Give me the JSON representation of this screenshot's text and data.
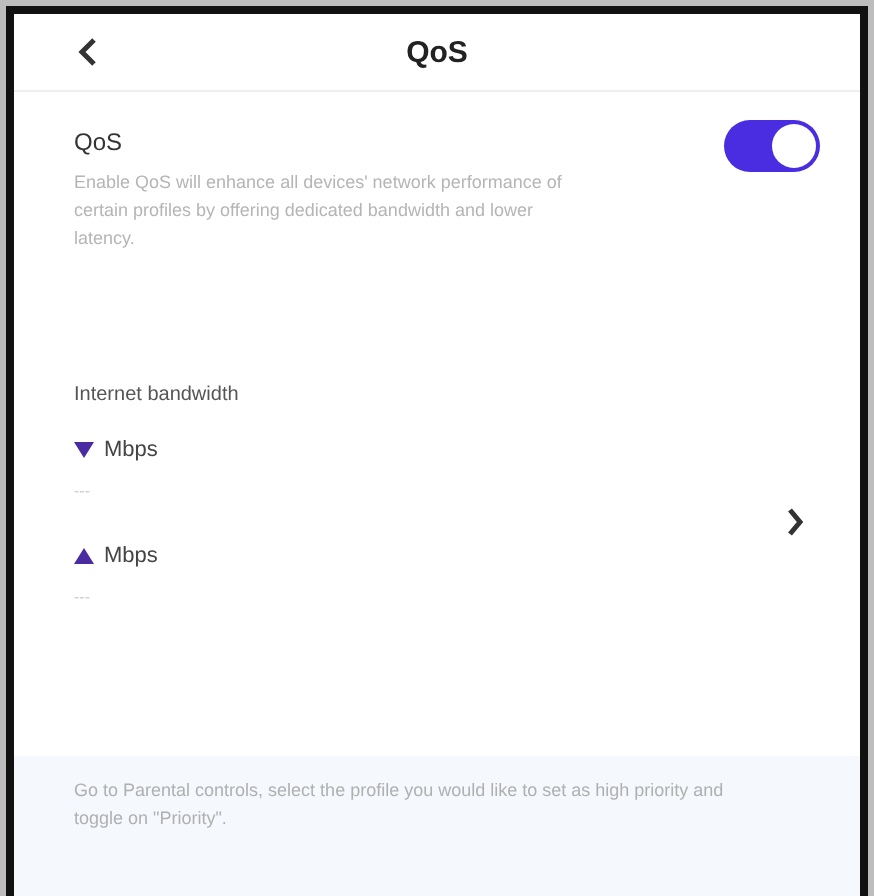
{
  "header": {
    "title": "QoS"
  },
  "qos": {
    "label": "QoS",
    "description": "Enable QoS will enhance all devices' network performance of certain profiles by offering dedicated bandwidth and lower latency.",
    "on": true
  },
  "bandwidth": {
    "heading": "Internet bandwidth",
    "rows": [
      {
        "kind": "download",
        "unit": "Mbps",
        "value": "---"
      },
      {
        "kind": "upload",
        "unit": "Mbps",
        "value": "---"
      }
    ]
  },
  "footer_note": "Go to Parental controls, select the profile you would like to set as high priority and toggle on \"Priority\"."
}
